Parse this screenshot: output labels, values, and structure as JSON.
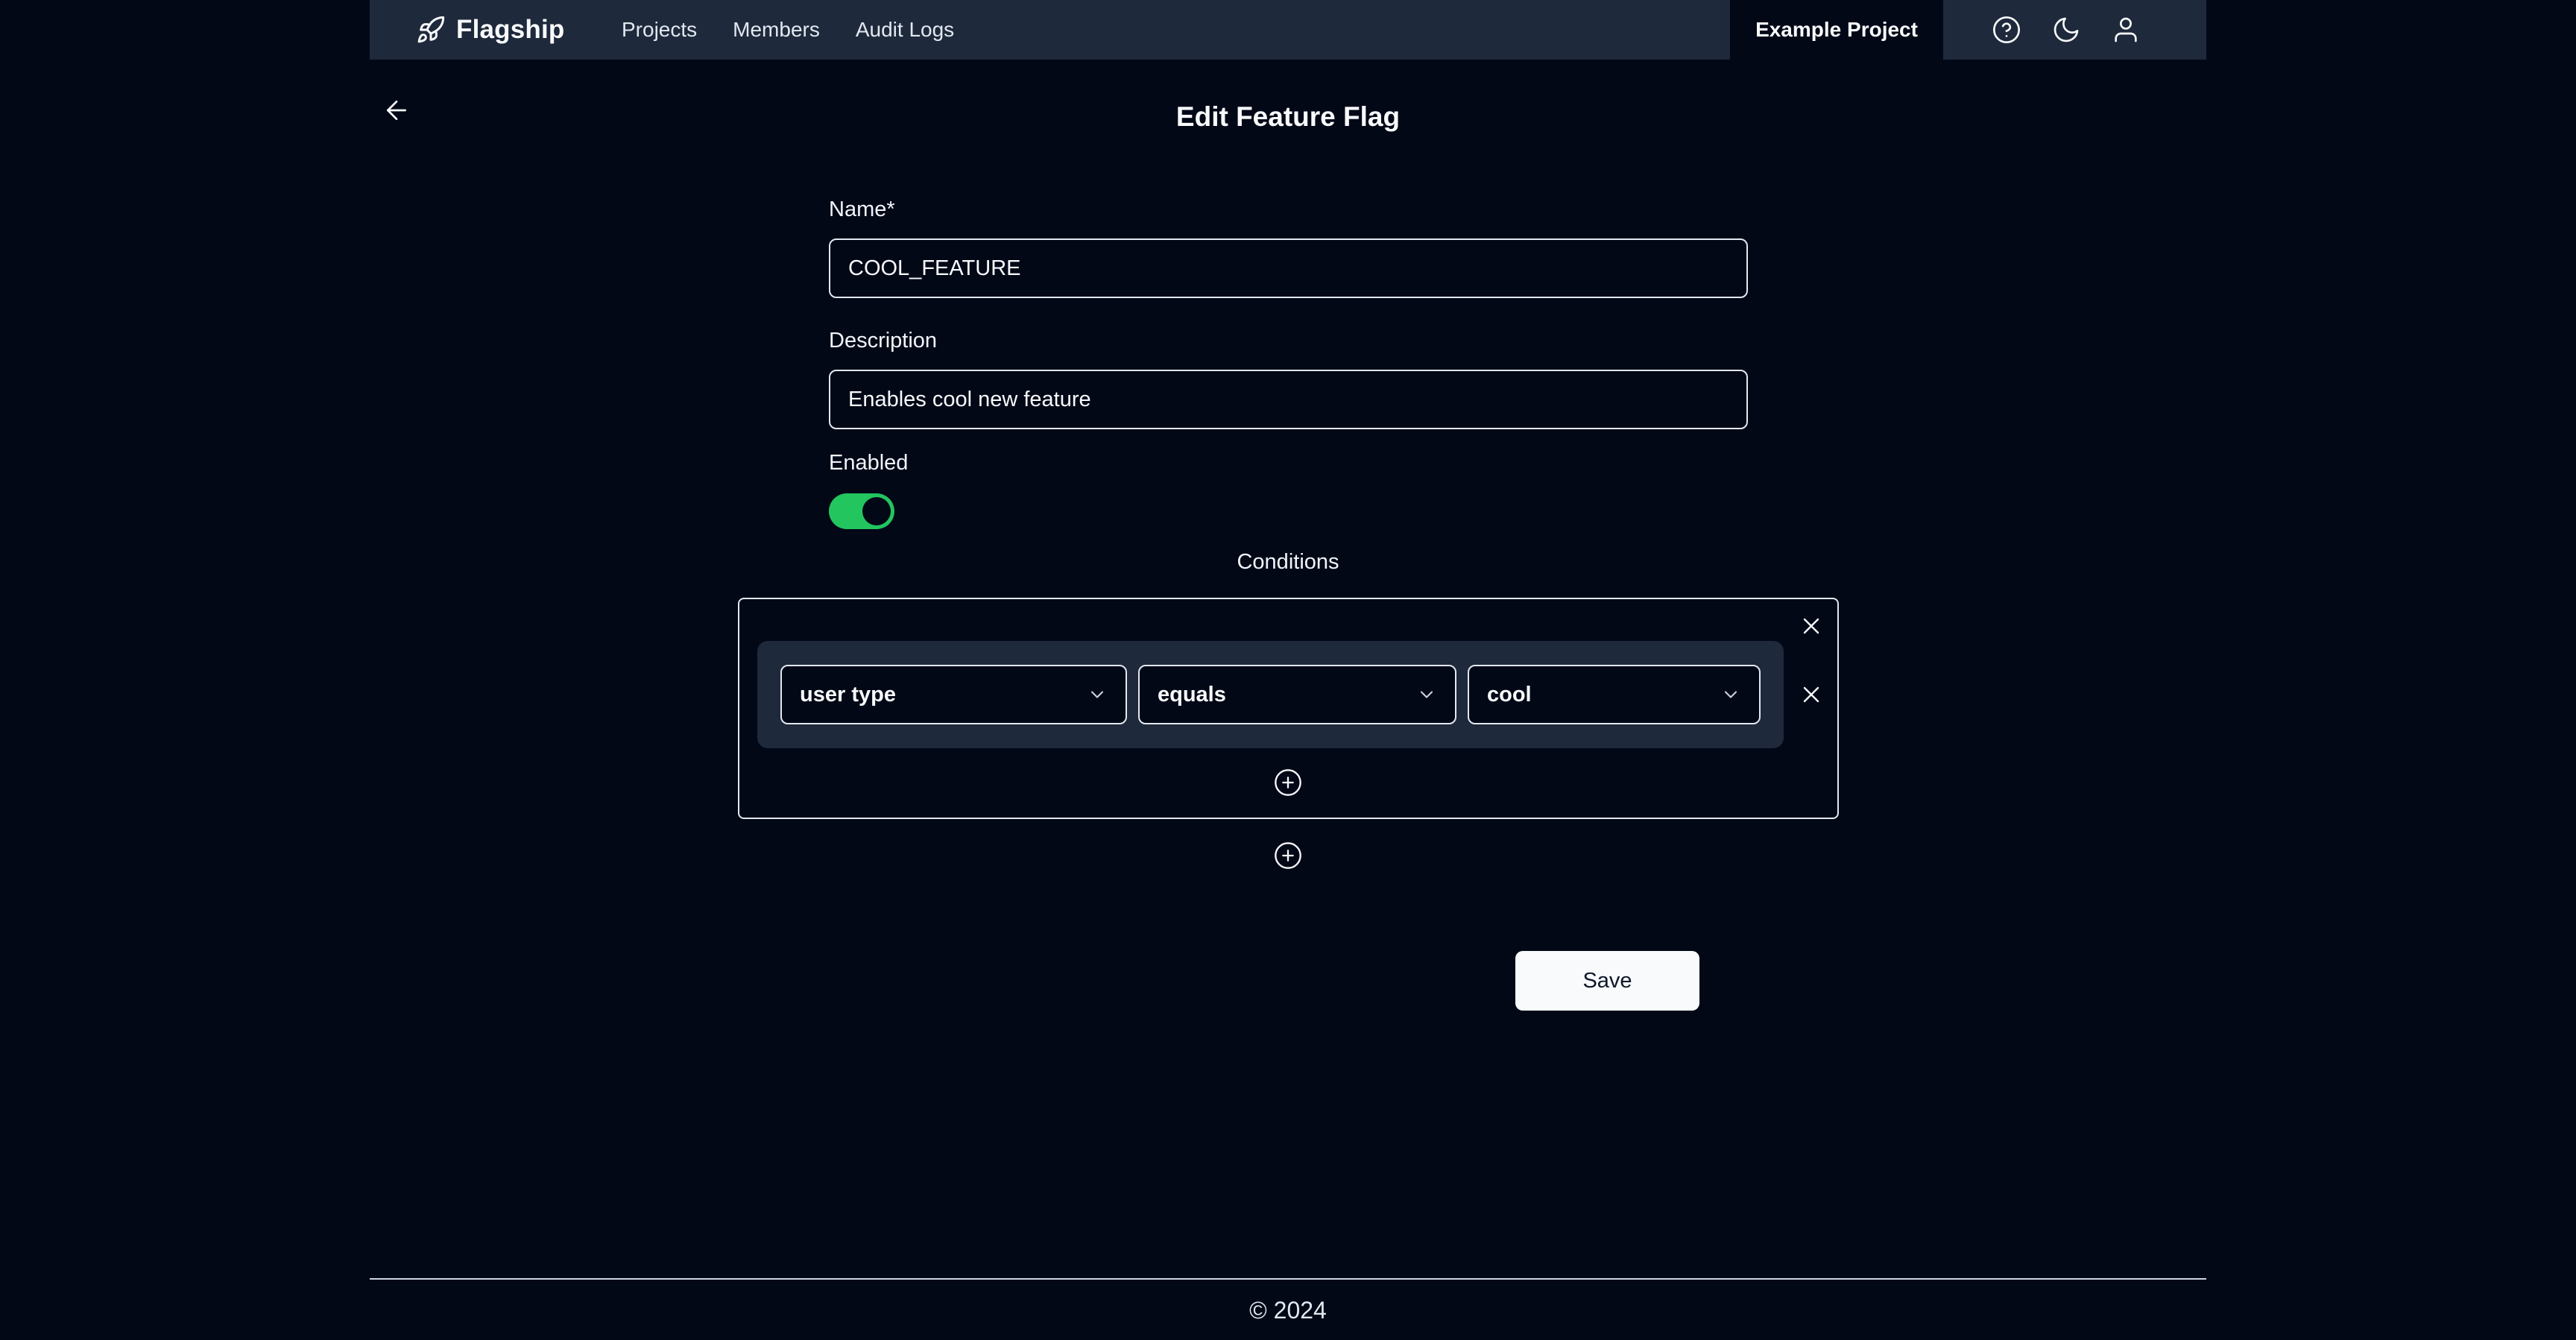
{
  "header": {
    "brand": "Flagship",
    "nav": [
      "Projects",
      "Members",
      "Audit Logs"
    ],
    "project": "Example Project",
    "icons": [
      "help-circle-icon",
      "moon-icon",
      "user-icon"
    ]
  },
  "page": {
    "title": "Edit Feature Flag"
  },
  "form": {
    "name_label": "Name*",
    "name_value": "COOL_FEATURE",
    "description_label": "Description",
    "description_value": "Enables cool new feature",
    "enabled_label": "Enabled",
    "enabled": true,
    "conditions_label": "Conditions",
    "condition_groups": [
      {
        "conditions": [
          {
            "attribute": "user type",
            "operator": "equals",
            "value": "cool"
          }
        ]
      }
    ],
    "save_label": "Save"
  },
  "colors": {
    "background": "#030817",
    "header": "#1e293b",
    "toggle_on": "#22c55e"
  },
  "footer": {
    "text": "© 2024"
  }
}
